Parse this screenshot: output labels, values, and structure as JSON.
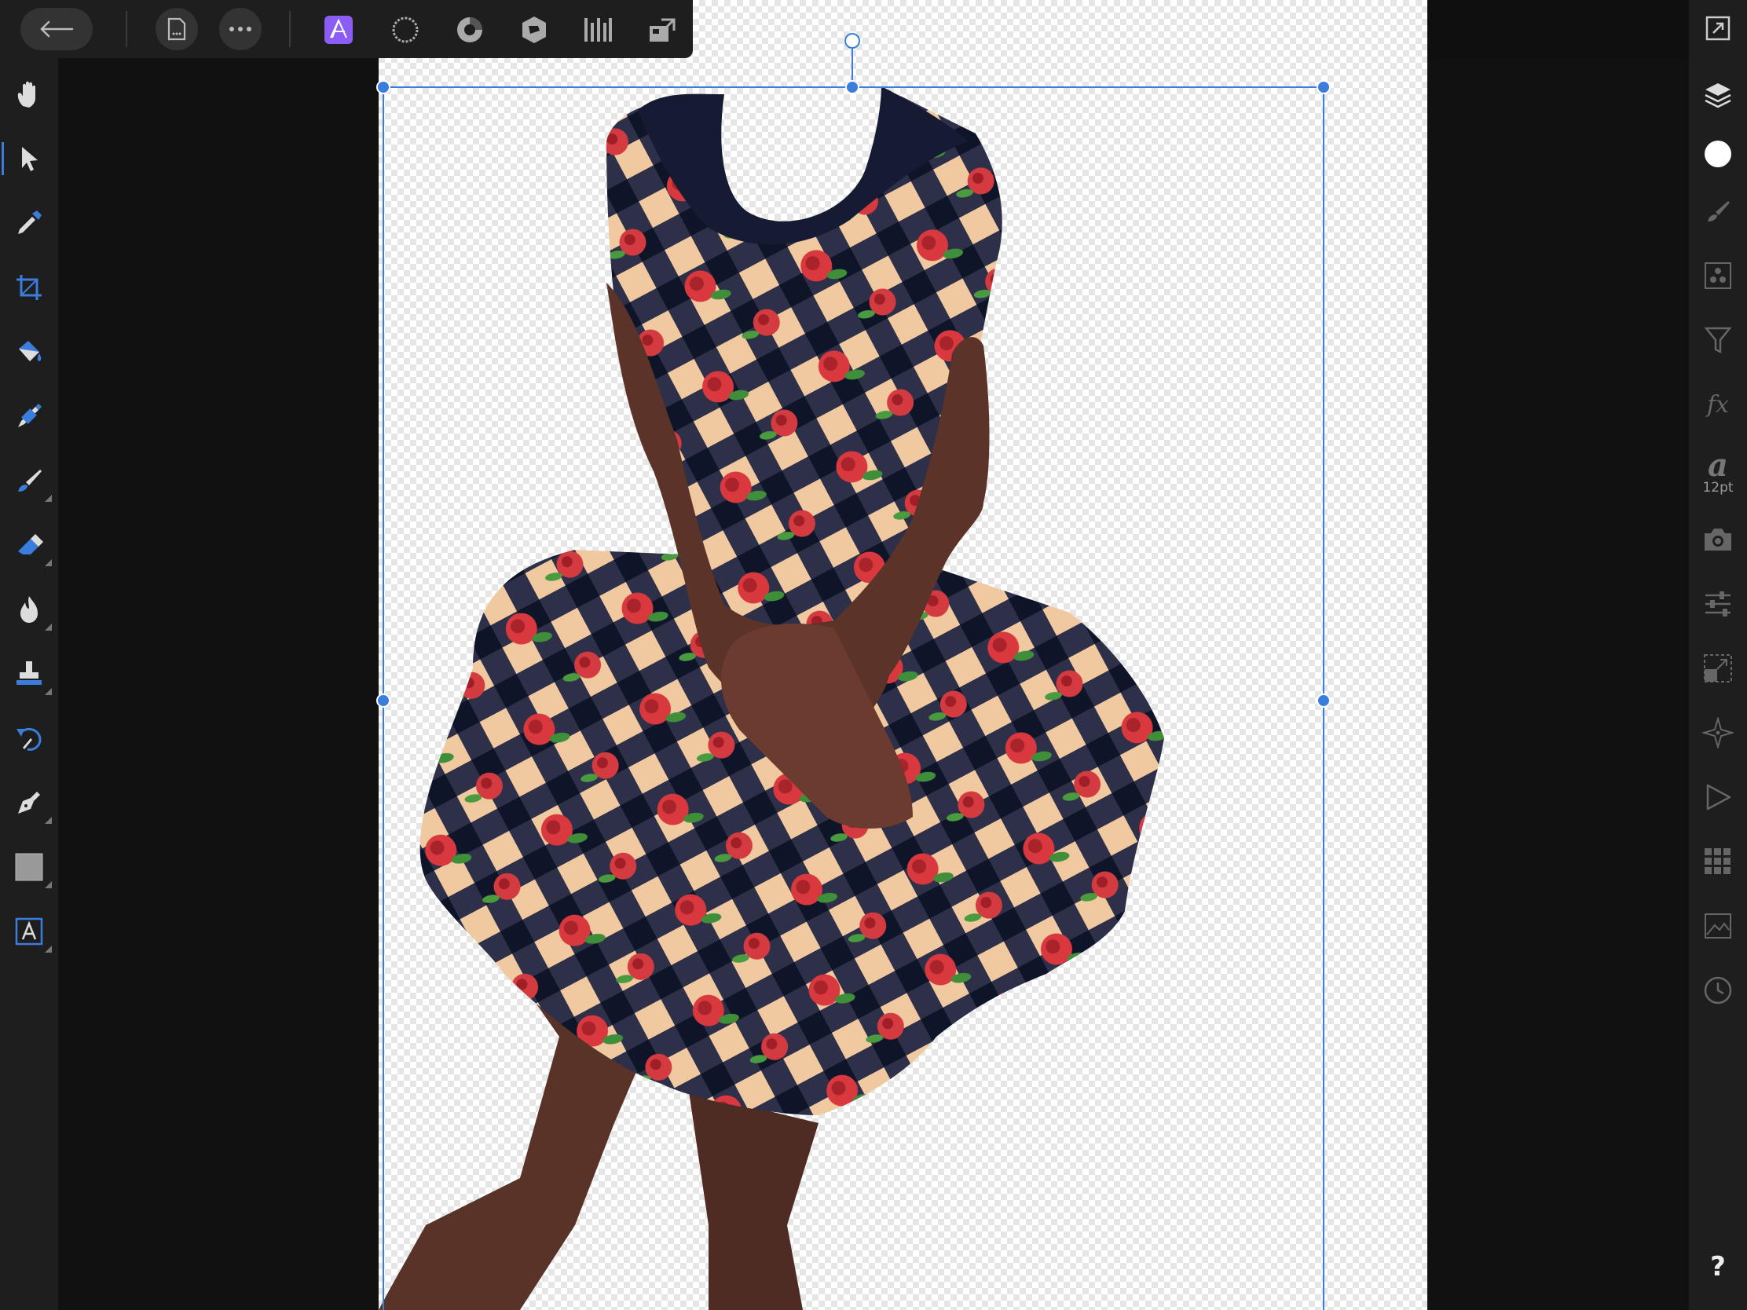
{
  "toolbar": {
    "back": "back-arrow-icon",
    "document_menu": "document-icon",
    "more_menu": "more-icon",
    "personas": [
      "photo-persona-icon",
      "liquify-persona-icon",
      "develop-persona-icon",
      "tone-mapping-persona-icon",
      "export-persona-icon"
    ],
    "export": "export-icon",
    "active_persona": "photo-persona-icon",
    "accent": "#8b5cf6"
  },
  "tools": [
    {
      "name": "view-tool",
      "icon": "hand-icon"
    },
    {
      "name": "move-tool",
      "icon": "pointer-icon",
      "active": true
    },
    {
      "name": "color-picker-tool",
      "icon": "eyedropper-icon"
    },
    {
      "name": "crop-tool",
      "icon": "crop-icon"
    },
    {
      "name": "flood-fill-tool",
      "icon": "paint-bucket-icon"
    },
    {
      "name": "selection-brush-tool",
      "icon": "selection-brush-icon"
    },
    {
      "name": "paint-brush-tool",
      "icon": "brush-icon"
    },
    {
      "name": "erase-brush-tool",
      "icon": "eraser-icon"
    },
    {
      "name": "burn-brush-tool",
      "icon": "flame-icon"
    },
    {
      "name": "clone-brush-tool",
      "icon": "stamp-icon"
    },
    {
      "name": "undo-brush-tool",
      "icon": "undo-brush-icon"
    },
    {
      "name": "pen-tool",
      "icon": "pen-nib-icon"
    },
    {
      "name": "rectangle-tool",
      "icon": "rectangle-icon"
    },
    {
      "name": "artistic-text-tool",
      "icon": "text-icon"
    }
  ],
  "studio": {
    "navigator": "navigator-icon",
    "layers": "layers-icon",
    "color": "color-icon",
    "brushes": "brushes-icon",
    "channels": "channels-icon",
    "adjustments": "filter-icon",
    "effects_label": "fx",
    "character_glyph": "a",
    "character_size": "12pt",
    "stock": "camera-icon",
    "transform": "sliders-icon",
    "layer_fx": "arrange-icon",
    "styles": "compass-icon",
    "macro": "play-icon",
    "library": "grid-icon",
    "image": "image-icon",
    "history": "history-icon",
    "help": "?"
  },
  "selection_color": "#3b7ddd"
}
